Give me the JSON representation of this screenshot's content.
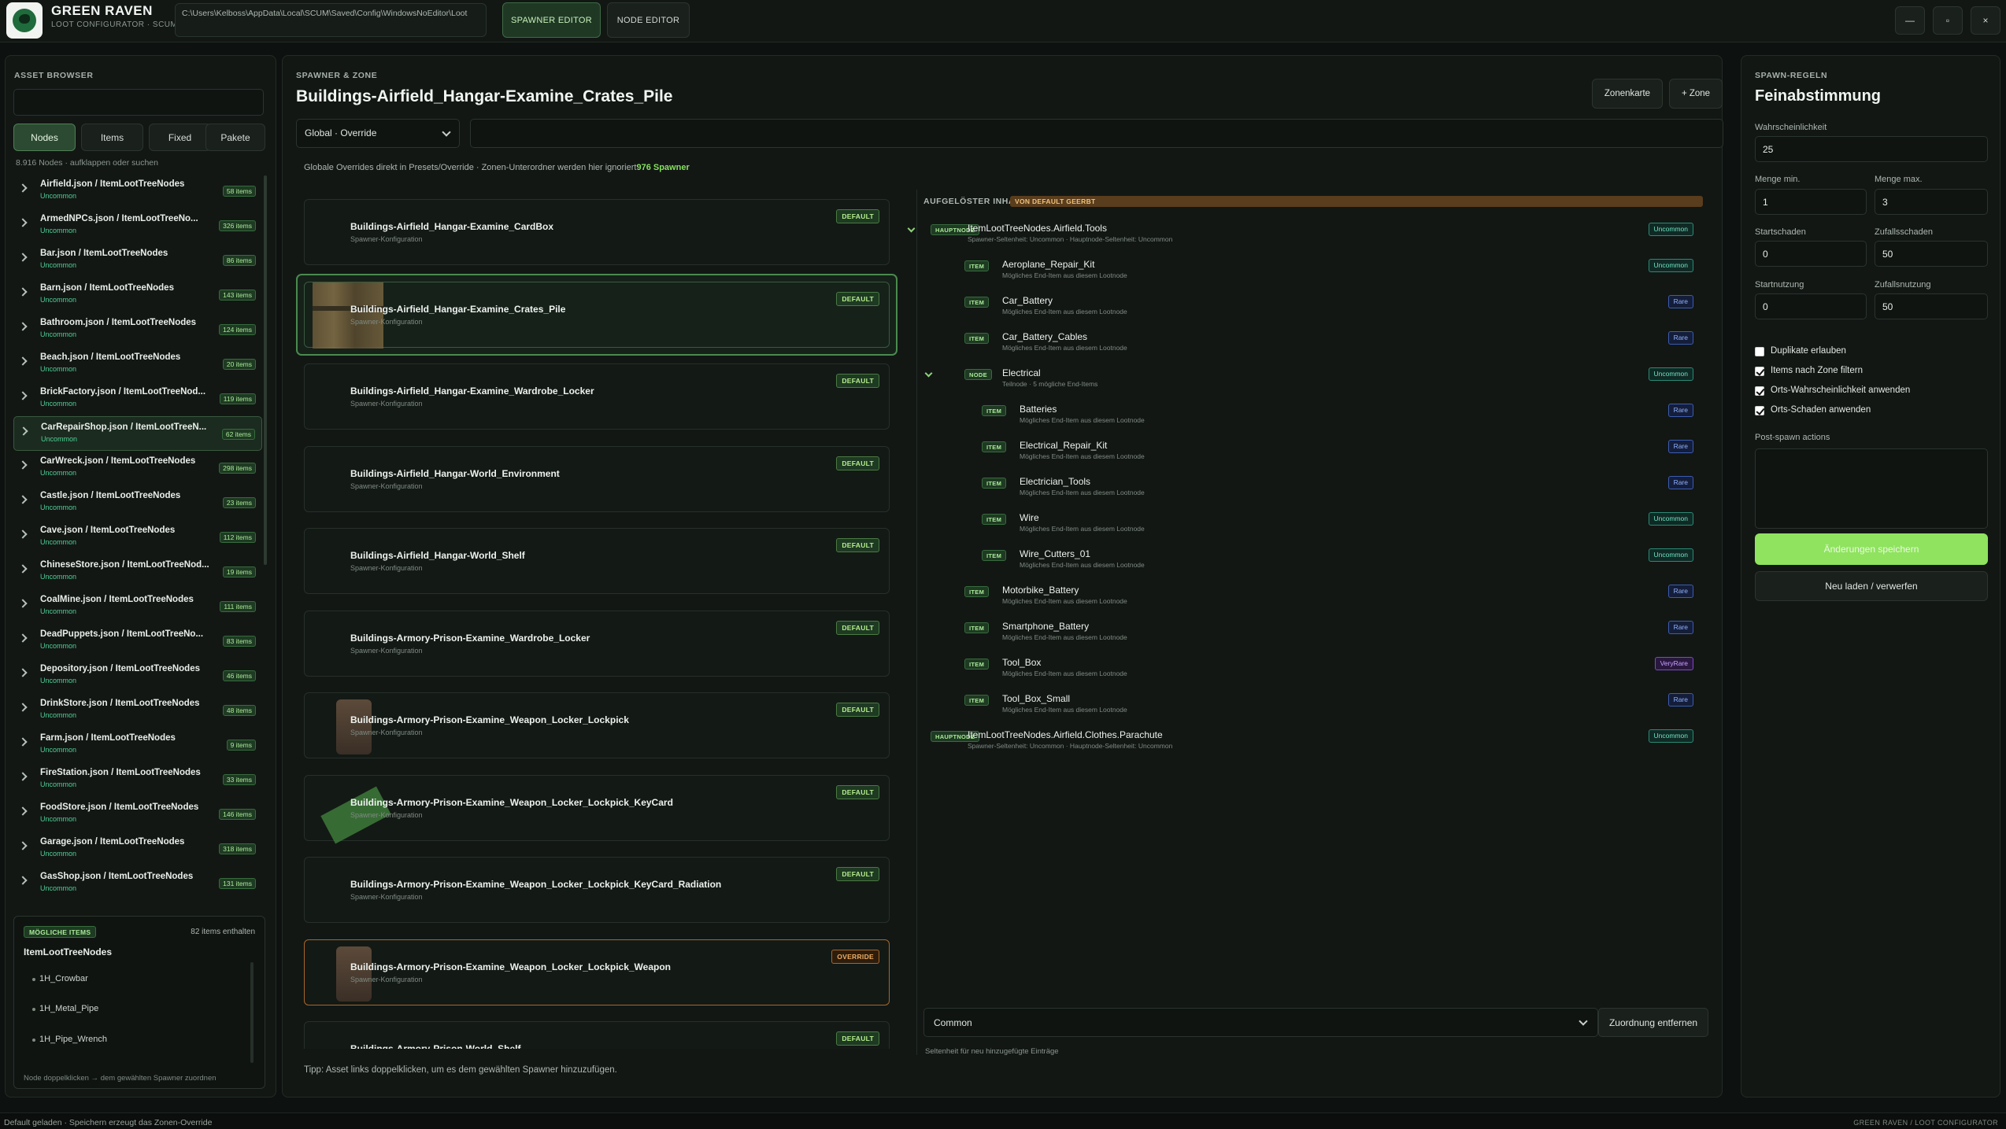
{
  "app": {
    "brand_title": "GREEN RAVEN",
    "brand_sub": "LOOT CONFIGURATOR · SCUM",
    "path": "C:\\Users\\Kelboss\\AppData\\Local\\SCUM\\Saved\\Config\\WindowsNoEditor\\Loot",
    "tabs": {
      "spawner": "SPAWNER EDITOR",
      "node": "NODE EDITOR"
    },
    "win": {
      "min": "—",
      "max": "▫",
      "close": "×"
    }
  },
  "asset_browser": {
    "title": "ASSET BROWSER",
    "tabs": [
      "Nodes",
      "Items",
      "Fixed",
      "Pakete"
    ],
    "active_tab": "Nodes",
    "count_text": "8.916 Nodes · aufklappen oder suchen",
    "nodes": [
      {
        "title": "Airfield.json  /  ItemLootTreeNodes",
        "rarity": "Uncommon",
        "count": "58 items"
      },
      {
        "title": "ArmedNPCs.json  /  ItemLootTreeNo...",
        "rarity": "Uncommon",
        "count": "326 items"
      },
      {
        "title": "Bar.json  /  ItemLootTreeNodes",
        "rarity": "Uncommon",
        "count": "86 items"
      },
      {
        "title": "Barn.json  /  ItemLootTreeNodes",
        "rarity": "Uncommon",
        "count": "143 items"
      },
      {
        "title": "Bathroom.json  /  ItemLootTreeNodes",
        "rarity": "Uncommon",
        "count": "124 items"
      },
      {
        "title": "Beach.json  /  ItemLootTreeNodes",
        "rarity": "Uncommon",
        "count": "20 items"
      },
      {
        "title": "BrickFactory.json  /  ItemLootTreeNod...",
        "rarity": "Uncommon",
        "count": "119 items"
      },
      {
        "title": "CarRepairShop.json  /  ItemLootTreeN...",
        "rarity": "Uncommon",
        "count": "62 items"
      },
      {
        "title": "CarWreck.json  /  ItemLootTreeNodes",
        "rarity": "Uncommon",
        "count": "298 items"
      },
      {
        "title": "Castle.json  /  ItemLootTreeNodes",
        "rarity": "Uncommon",
        "count": "23 items"
      },
      {
        "title": "Cave.json  /  ItemLootTreeNodes",
        "rarity": "Uncommon",
        "count": "112 items"
      },
      {
        "title": "ChineseStore.json  /  ItemLootTreeNod...",
        "rarity": "Uncommon",
        "count": "19 items"
      },
      {
        "title": "CoalMine.json  /  ItemLootTreeNodes",
        "rarity": "Uncommon",
        "count": "111 items"
      },
      {
        "title": "DeadPuppets.json  /  ItemLootTreeNo...",
        "rarity": "Uncommon",
        "count": "83 items"
      },
      {
        "title": "Depository.json  /  ItemLootTreeNodes",
        "rarity": "Uncommon",
        "count": "46 items"
      },
      {
        "title": "DrinkStore.json  /  ItemLootTreeNodes",
        "rarity": "Uncommon",
        "count": "48 items"
      },
      {
        "title": "Farm.json  /  ItemLootTreeNodes",
        "rarity": "Uncommon",
        "count": "9 items"
      },
      {
        "title": "FireStation.json  /  ItemLootTreeNodes",
        "rarity": "Uncommon",
        "count": "33 items"
      },
      {
        "title": "FoodStore.json  /  ItemLootTreeNodes",
        "rarity": "Uncommon",
        "count": "146 items"
      },
      {
        "title": "Garage.json  /  ItemLootTreeNodes",
        "rarity": "Uncommon",
        "count": "318 items"
      },
      {
        "title": "GasShop.json  /  ItemLootTreeNodes",
        "rarity": "Uncommon",
        "count": "131 items"
      }
    ],
    "selected_index": 7,
    "possible": {
      "badge": "MÖGLICHE ITEMS",
      "count": "82 items enthalten",
      "title": "ItemLootTreeNodes",
      "items": [
        "1H_Crowbar",
        "1H_Metal_Pipe",
        "1H_Pipe_Wrench"
      ],
      "hint": "Node doppelklicken → dem gewählten Spawner zuordnen"
    }
  },
  "spawner_zone": {
    "eyebrow": "SPAWNER & ZONE",
    "title": "Buildings-Airfield_Hangar-Examine_Crates_Pile",
    "btn_map": "Zonenkarte",
    "btn_zone": "+ Zone",
    "scope": "Global · Override",
    "info_text": "Globale Overrides direkt in Presets/Override · Zonen-Unterordner werden hier ignoriert",
    "info_count": "976 Spawner",
    "spawner_sub": "Spawner-Konfiguration",
    "spawners": [
      {
        "name": "Buildings-Airfield_Hangar-Examine_CardBox",
        "badge": "DEFAULT",
        "thumb": "none"
      },
      {
        "name": "Buildings-Airfield_Hangar-Examine_Crates_Pile",
        "badge": "DEFAULT",
        "thumb": "crate"
      },
      {
        "name": "Buildings-Airfield_Hangar-Examine_Wardrobe_Locker",
        "badge": "DEFAULT",
        "thumb": "none"
      },
      {
        "name": "Buildings-Airfield_Hangar-World_Environment",
        "badge": "DEFAULT",
        "thumb": "none"
      },
      {
        "name": "Buildings-Airfield_Hangar-World_Shelf",
        "badge": "DEFAULT",
        "thumb": "none"
      },
      {
        "name": "Buildings-Armory-Prison-Examine_Wardrobe_Locker",
        "badge": "DEFAULT",
        "thumb": "none"
      },
      {
        "name": "Buildings-Armory-Prison-Examine_Weapon_Locker_Lockpick",
        "badge": "DEFAULT",
        "thumb": "jar"
      },
      {
        "name": "Buildings-Armory-Prison-Examine_Weapon_Locker_Lockpick_KeyCard",
        "badge": "DEFAULT",
        "thumb": "card"
      },
      {
        "name": "Buildings-Armory-Prison-Examine_Weapon_Locker_Lockpick_KeyCard_Radiation",
        "badge": "DEFAULT",
        "thumb": "none"
      },
      {
        "name": "Buildings-Armory-Prison-Examine_Weapon_Locker_Lockpick_Weapon",
        "badge": "OVERRIDE",
        "thumb": "jar"
      },
      {
        "name": "Buildings-Armory-Prison-World_Shelf",
        "badge": "DEFAULT",
        "thumb": "none"
      }
    ],
    "selected_index": 1,
    "tip": "Tipp: Asset links doppelklicken, um es dem gewählten Spawner hinzuzufügen."
  },
  "resolved": {
    "title": "AUFGELÖSTER INHALT",
    "banner": "VON DEFAULT GEERBT",
    "item_sub": "Mögliches End-Item aus diesem Lootnode",
    "tree": [
      {
        "level": 0,
        "type": "HAUPTNODE",
        "name": "ItemLootTreeNodes.Airfield.Tools",
        "sub": "Spawner-Seltenheit: Uncommon · Hauptnode-Seltenheit: Uncommon",
        "rarity": "Uncommon",
        "expanded": true
      },
      {
        "level": 1,
        "type": "ITEM",
        "name": "Aeroplane_Repair_Kit",
        "sub": "Mögliches End-Item aus diesem Lootnode",
        "rarity": "Uncommon"
      },
      {
        "level": 1,
        "type": "ITEM",
        "name": "Car_Battery",
        "sub": "Mögliches End-Item aus diesem Lootnode",
        "rarity": "Rare"
      },
      {
        "level": 1,
        "type": "ITEM",
        "name": "Car_Battery_Cables",
        "sub": "Mögliches End-Item aus diesem Lootnode",
        "rarity": "Rare"
      },
      {
        "level": 1,
        "type": "NODE",
        "name": "Electrical",
        "sub": "Teilnode · 5 mögliche End-Items",
        "rarity": "Uncommon",
        "expanded": true
      },
      {
        "level": 2,
        "type": "ITEM",
        "name": "Batteries",
        "sub": "Mögliches End-Item aus diesem Lootnode",
        "rarity": "Rare"
      },
      {
        "level": 2,
        "type": "ITEM",
        "name": "Electrical_Repair_Kit",
        "sub": "Mögliches End-Item aus diesem Lootnode",
        "rarity": "Rare"
      },
      {
        "level": 2,
        "type": "ITEM",
        "name": "Electrician_Tools",
        "sub": "Mögliches End-Item aus diesem Lootnode",
        "rarity": "Rare"
      },
      {
        "level": 2,
        "type": "ITEM",
        "name": "Wire",
        "sub": "Mögliches End-Item aus diesem Lootnode",
        "rarity": "Uncommon"
      },
      {
        "level": 2,
        "type": "ITEM",
        "name": "Wire_Cutters_01",
        "sub": "Mögliches End-Item aus diesem Lootnode",
        "rarity": "Uncommon"
      },
      {
        "level": 1,
        "type": "ITEM",
        "name": "Motorbike_Battery",
        "sub": "Mögliches End-Item aus diesem Lootnode",
        "rarity": "Rare"
      },
      {
        "level": 1,
        "type": "ITEM",
        "name": "Smartphone_Battery",
        "sub": "Mögliches End-Item aus diesem Lootnode",
        "rarity": "Rare"
      },
      {
        "level": 1,
        "type": "ITEM",
        "name": "Tool_Box",
        "sub": "Mögliches End-Item aus diesem Lootnode",
        "rarity": "VeryRare"
      },
      {
        "level": 1,
        "type": "ITEM",
        "name": "Tool_Box_Small",
        "sub": "Mögliches End-Item aus diesem Lootnode",
        "rarity": "Rare"
      },
      {
        "level": 0,
        "type": "HAUPTNODE",
        "name": "ItemLootTreeNodes.Airfield.Clothes.Parachute",
        "sub": "Spawner-Seltenheit: Uncommon · Hauptnode-Seltenheit: Uncommon",
        "rarity": "Uncommon",
        "expanded": false
      }
    ],
    "foot_label": "Seltenheit für neu hinzugefügte Einträge",
    "rarity_value": "Common",
    "btn_remove": "Zuordnung entfernen"
  },
  "rules": {
    "eyebrow": "SPAWN-REGELN",
    "title": "Feinabstimmung",
    "prob_label": "Wahrscheinlichkeit",
    "prob_value": "25",
    "qmin_label": "Menge min.",
    "qmin_value": "1",
    "qmax_label": "Menge max.",
    "qmax_value": "3",
    "sdmg_label": "Startschaden",
    "sdmg_value": "0",
    "rdmg_label": "Zufallsschaden",
    "rdmg_value": "50",
    "suse_label": "Startnutzung",
    "suse_value": "0",
    "ruse_label": "Zufallsnutzung",
    "ruse_value": "50",
    "checks": [
      {
        "label": "Duplikate erlauben",
        "checked": false
      },
      {
        "label": "Items nach Zone filtern",
        "checked": true
      },
      {
        "label": "Orts-Wahrscheinlichkeit anwenden",
        "checked": true
      },
      {
        "label": "Orts-Schaden anwenden",
        "checked": true
      }
    ],
    "post_label": "Post-spawn actions",
    "btn_save": "Änderungen speichern",
    "btn_reload": "Neu laden / verwerfen"
  },
  "status": {
    "left": "Default geladen · Speichern erzeugt das Zonen-Override",
    "right": "GREEN RAVEN  /  LOOT CONFIGURATOR"
  },
  "colors": {
    "accent_green": "#8fe35e",
    "uncommon": "#6fe3c2",
    "rare": "#91b0ff",
    "very_rare": "#c7a2ff",
    "override": "#f0ad62"
  }
}
